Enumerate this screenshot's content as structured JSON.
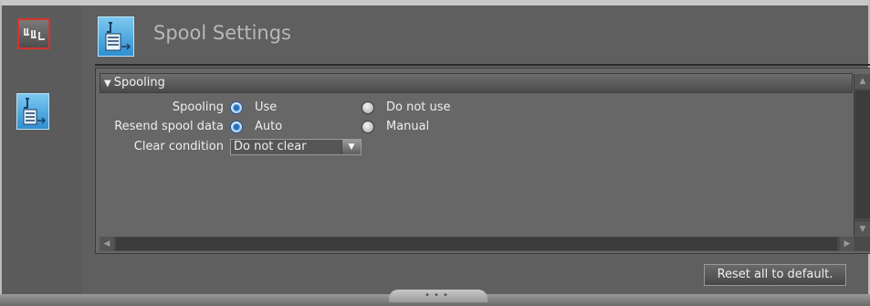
{
  "header": {
    "title": "Spool Settings"
  },
  "section": {
    "title": "Spooling",
    "toggle_icon": "triangle-down-icon"
  },
  "fields": {
    "spooling": {
      "label": "Spooling",
      "options": [
        "Use",
        "Do not use"
      ],
      "selected": "Use"
    },
    "resend": {
      "label": "Resend spool data",
      "options": [
        "Auto",
        "Manual"
      ],
      "selected": "Auto"
    },
    "clear_condition": {
      "label": "Clear condition",
      "value": "Do not clear"
    }
  },
  "footer": {
    "reset_label": "Reset all to default."
  },
  "left_rail": {
    "icons": [
      "connection-settings-icon",
      "spool-settings-icon"
    ]
  },
  "colors": {
    "active_border": "#d8322e",
    "icon_blue": "#2f8fd0",
    "radio_selected": "#2a6fb8"
  }
}
